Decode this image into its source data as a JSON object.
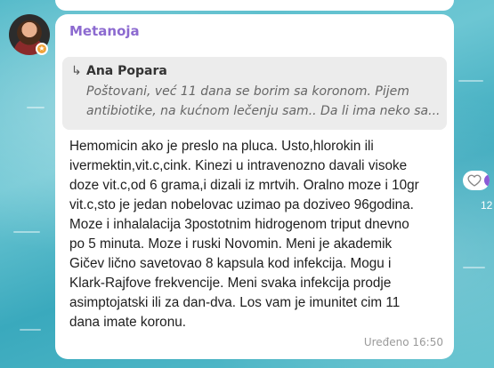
{
  "message": {
    "author": "Metanoja",
    "reply": {
      "arrow": "↳",
      "author": "Ana Popara",
      "text_lines": [
        "Poštovani, već 11 dana se borim sa koronom. Pijem",
        "antibiotike, na kućnom lečenju sam.. Da li ima neko sa..."
      ]
    },
    "text_lines": [
      "Hemomicin ako je preslo na pluca. Usto,hlorokin ili",
      "ivermektin,vit.c,cink. Kinezi u intravenozno davali visoke",
      "doze vit.c,od 6 grama,i dizali iz mrtvih. Oralno moze i 10gr",
      "vit.c,sto je jedan nobelovac uzimao pa doziveo 96godina.",
      "Moze i inhalalacija 3postotnim hidrogenom triput dnevno",
      "po 5 minuta. Moze i ruski Novomin. Meni je akademik",
      "Gičev lično savetovao 8 kapsula kod infekcija. Mogu i",
      "Klark-Rajfove frekvencije. Meni svaka infekcija prodje",
      "asimptojatski ili za dan-dva. Los vam je imunitet cim 11",
      "dana imate koronu."
    ],
    "meta": "Uređeno 16:50",
    "avatar_badge": "★"
  },
  "side": {
    "reaction_count": "12",
    "reaction_icon": "heart-icon"
  }
}
